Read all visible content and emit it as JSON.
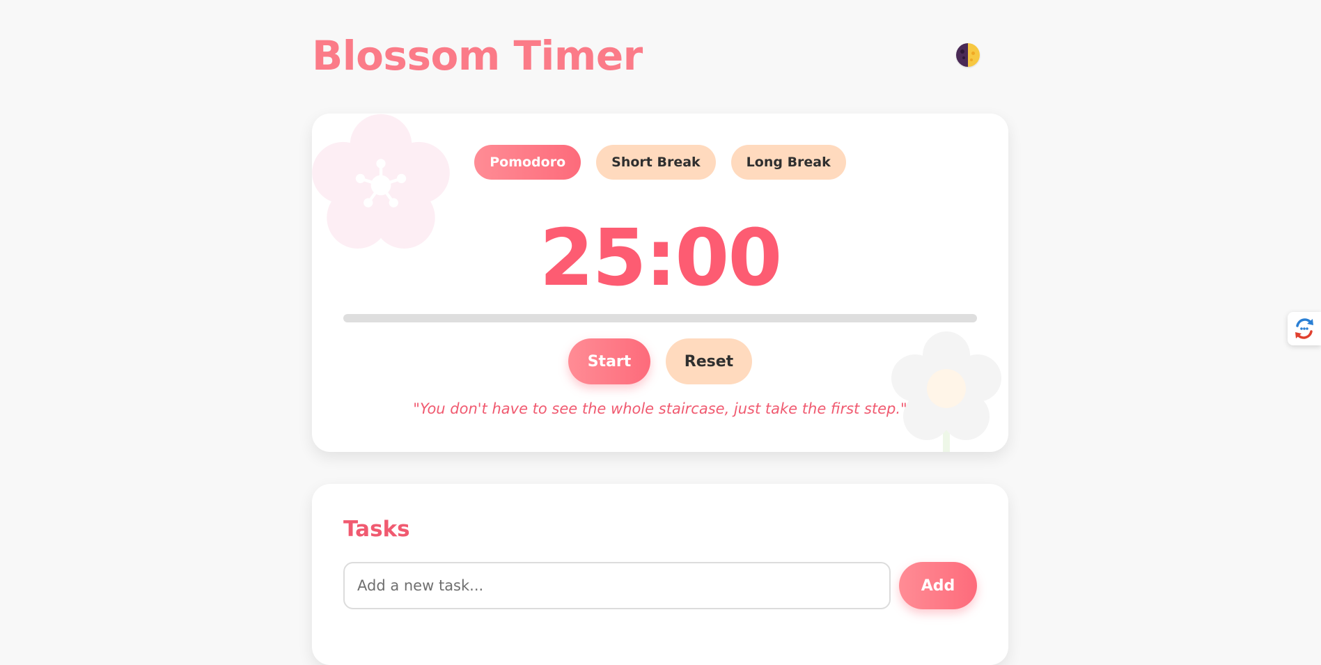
{
  "app": {
    "title": "Blossom Timer"
  },
  "header": {
    "theme_toggle_icon": "moon-sun-icon"
  },
  "timer": {
    "modes": [
      {
        "label": "Pomodoro",
        "active": true
      },
      {
        "label": "Short Break",
        "active": false
      },
      {
        "label": "Long Break",
        "active": false
      }
    ],
    "time": "25:00",
    "progress_percent": 0,
    "start_label": "Start",
    "reset_label": "Reset",
    "quote": "\"You don't have to see the whole staircase, just take the first step.\""
  },
  "tasks": {
    "title": "Tasks",
    "input_placeholder": "Add a new task...",
    "input_value": "",
    "add_label": "Add"
  },
  "side_widget": {
    "icon": "translate-sync-icon"
  },
  "colors": {
    "accent": "#fd6b7b",
    "accent_light": "#ff8c95",
    "peach": "#ffdabe",
    "quote": "#f05a70",
    "background": "#f8f8f8"
  }
}
